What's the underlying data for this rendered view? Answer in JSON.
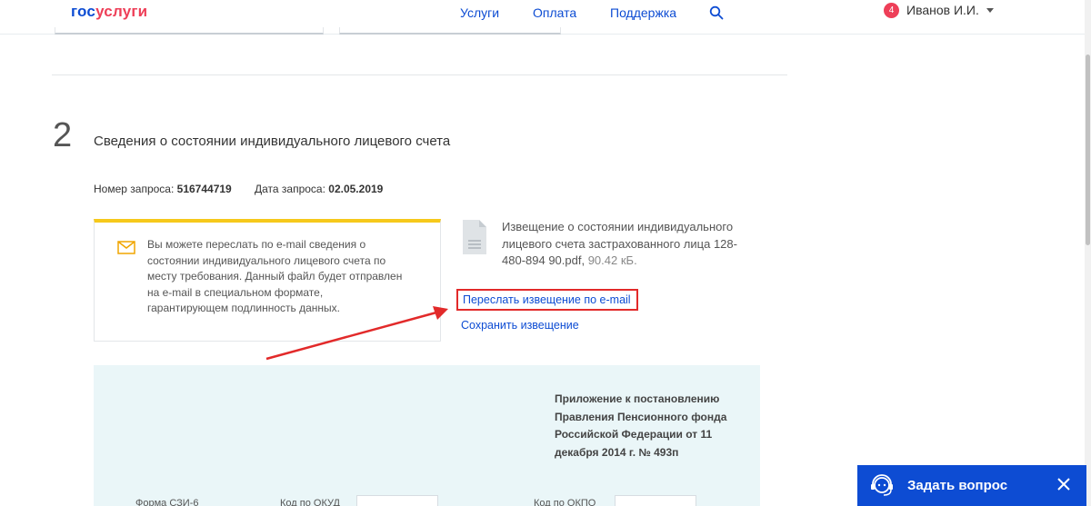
{
  "header": {
    "logo_part1": "гос",
    "logo_part2": "услуги",
    "nav": [
      "Услуги",
      "Оплата",
      "Поддержка"
    ],
    "user": {
      "badge": "4",
      "name": "Иванов И.И."
    }
  },
  "section": {
    "number": "2",
    "title": "Сведения о состоянии индивидуального лицевого счета",
    "request_number_label": "Номер запроса:",
    "request_number": "516744719",
    "request_date_label": "Дата запроса:",
    "request_date": "02.05.2019"
  },
  "info_box": {
    "text": "Вы можете переслать по e-mail сведения о состоянии индивидуального лицевого счета по месту требования. Данный файл будет отправлен на e-mail в специальном формате, гарантирующем подлинность данных."
  },
  "file": {
    "name": "Извещение о состоянии индивидуального лицевого счета застрахованного лица 128-480-894 90.pdf,",
    "size": "90.42 кБ."
  },
  "links": {
    "forward": "Переслать извещение по e-mail",
    "save": "Сохранить извещение"
  },
  "document": {
    "annex": "Приложение к постановлению Правления Пенсионного фонда Российской Федерации от 11 декабря 2014 г. № 493п",
    "form_label": "Форма СЗИ-6",
    "okud_label": "Код по ОКУД",
    "okpo_label": "Код по ОКПО"
  },
  "widget": {
    "label": "Задать вопрос"
  },
  "colors": {
    "brand_blue": "#0d4cd3",
    "brand_red": "#ee3f58",
    "highlight_red": "#e22a2a",
    "accent_yellow": "#f6c91b",
    "preview_bg": "#eaf6f8"
  }
}
